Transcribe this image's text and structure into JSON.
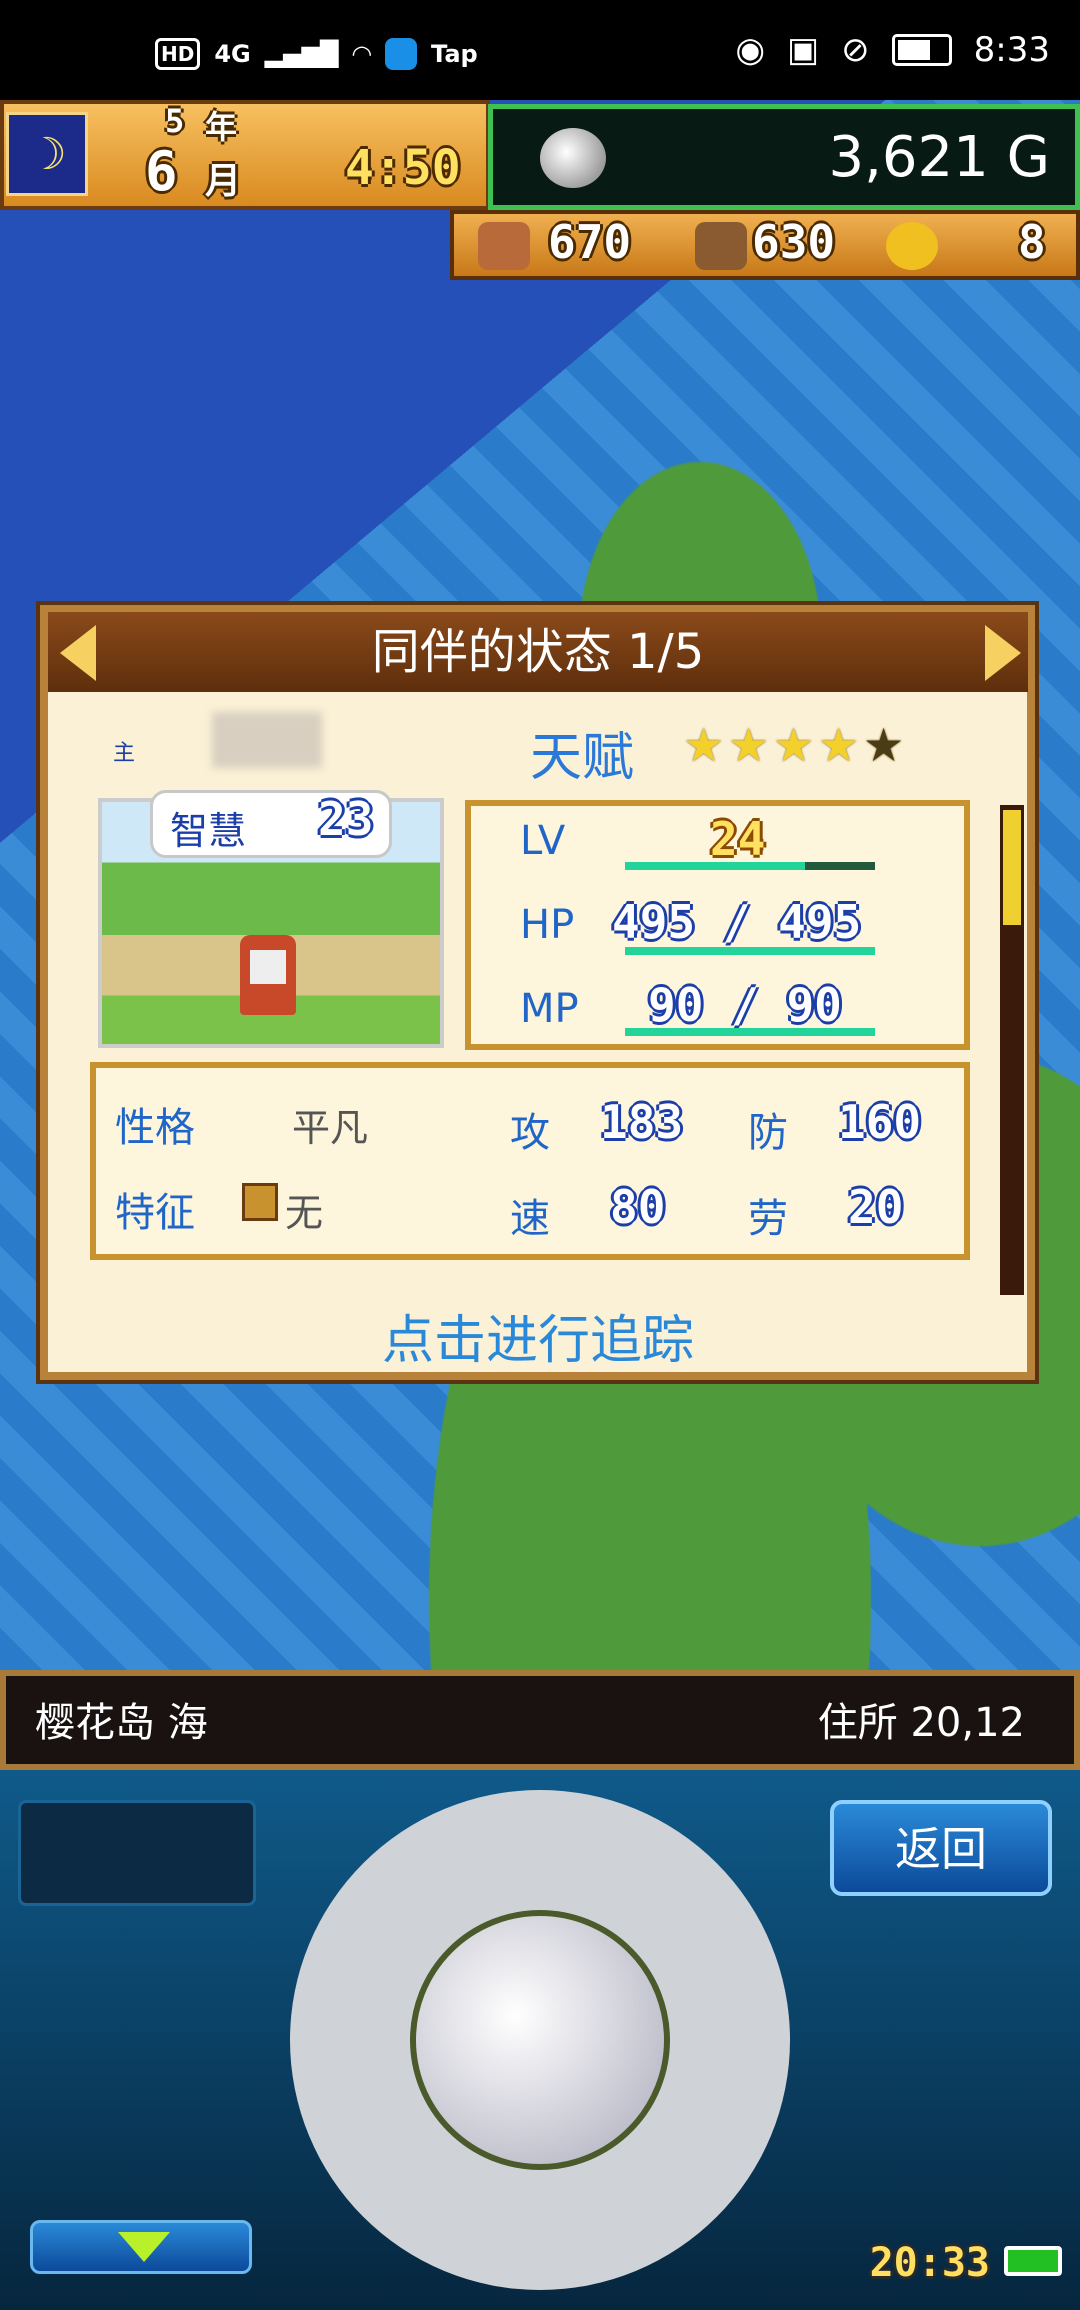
{
  "status_bar": {
    "hd": "HD",
    "network": "4G",
    "tap": "Tap",
    "time": "8:33",
    "icons": [
      "signal-icon",
      "wifi-icon",
      "tap-icon",
      "eye-icon",
      "nfc-icon",
      "mute-icon",
      "battery-icon"
    ]
  },
  "hud": {
    "year": "5",
    "year_label": "年",
    "month": "6",
    "month_label": "月",
    "clock": "4:50",
    "gold": "3,621 G",
    "resources": [
      {
        "icon": "food-icon",
        "value": "670"
      },
      {
        "icon": "wood-icon",
        "value": "630"
      },
      {
        "icon": "medal-icon",
        "value": "8"
      }
    ]
  },
  "dialog": {
    "title": "同伴的状态 1/5",
    "master_label": "主",
    "talent_label": "天赋",
    "talent_stars": 4,
    "talent_max": 5,
    "wisdom_label": "智慧",
    "wisdom_value": "23",
    "lv_label": "LV",
    "lv_value": "24",
    "lv_progress": 0.72,
    "hp_label": "HP",
    "hp_value": "495 / 495",
    "hp_progress": 1.0,
    "mp_label": "MP",
    "mp_value": "90 / 90",
    "mp_progress": 1.0,
    "personality_label": "性格",
    "personality_value": "平凡",
    "trait_label": "特征",
    "trait_value": "无",
    "atk_label": "攻",
    "atk_value": "183",
    "def_label": "防",
    "def_value": "160",
    "spd_label": "速",
    "spd_value": "80",
    "labor_label": "劳",
    "labor_value": "20",
    "track_link": "点击进行追踪"
  },
  "info_bar": {
    "location": "樱花岛 海",
    "address": "住所  20,12"
  },
  "controls": {
    "back_label": "返回",
    "game_clock": "20:33"
  },
  "colors": {
    "accent_blue": "#2066c8",
    "hud_green": "#3fc050",
    "star_gold": "#f4d12a"
  }
}
